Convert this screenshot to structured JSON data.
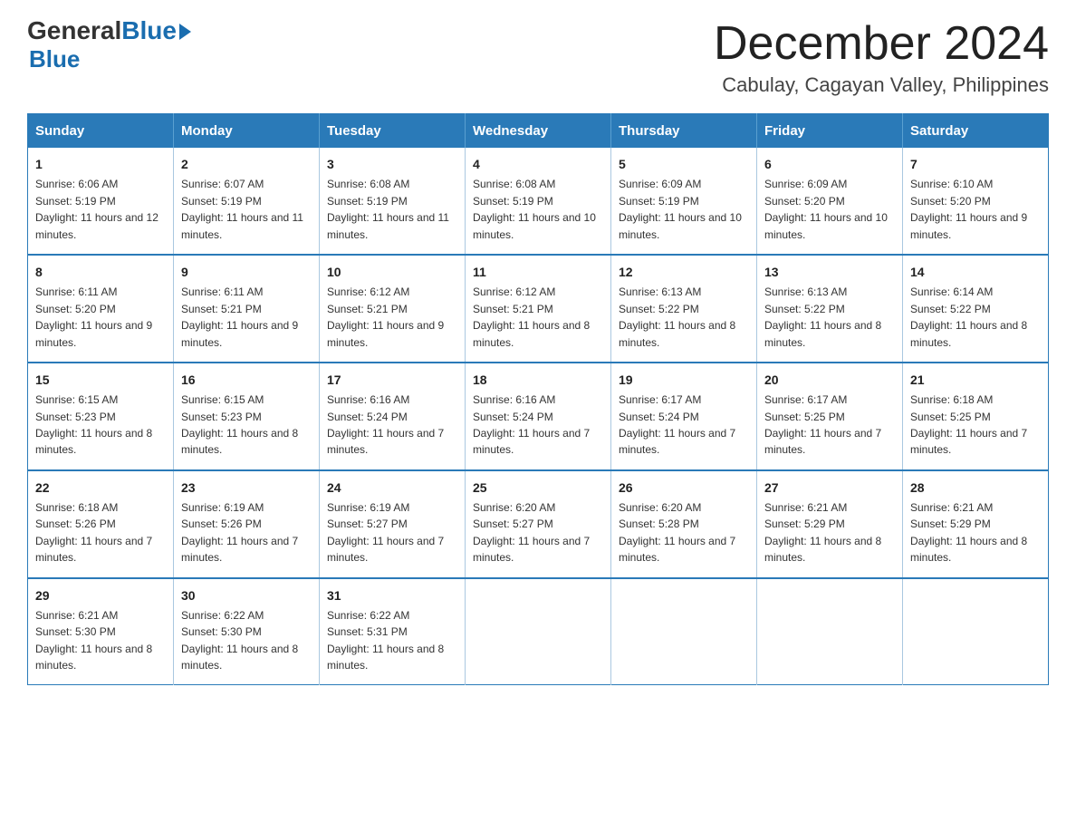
{
  "logo": {
    "general": "General",
    "blue": "Blue",
    "triangle": true
  },
  "header": {
    "month_title": "December 2024",
    "location": "Cabulay, Cagayan Valley, Philippines"
  },
  "days_of_week": [
    "Sunday",
    "Monday",
    "Tuesday",
    "Wednesday",
    "Thursday",
    "Friday",
    "Saturday"
  ],
  "weeks": [
    [
      {
        "day": "1",
        "sunrise": "6:06 AM",
        "sunset": "5:19 PM",
        "daylight": "11 hours and 12 minutes."
      },
      {
        "day": "2",
        "sunrise": "6:07 AM",
        "sunset": "5:19 PM",
        "daylight": "11 hours and 11 minutes."
      },
      {
        "day": "3",
        "sunrise": "6:08 AM",
        "sunset": "5:19 PM",
        "daylight": "11 hours and 11 minutes."
      },
      {
        "day": "4",
        "sunrise": "6:08 AM",
        "sunset": "5:19 PM",
        "daylight": "11 hours and 10 minutes."
      },
      {
        "day": "5",
        "sunrise": "6:09 AM",
        "sunset": "5:19 PM",
        "daylight": "11 hours and 10 minutes."
      },
      {
        "day": "6",
        "sunrise": "6:09 AM",
        "sunset": "5:20 PM",
        "daylight": "11 hours and 10 minutes."
      },
      {
        "day": "7",
        "sunrise": "6:10 AM",
        "sunset": "5:20 PM",
        "daylight": "11 hours and 9 minutes."
      }
    ],
    [
      {
        "day": "8",
        "sunrise": "6:11 AM",
        "sunset": "5:20 PM",
        "daylight": "11 hours and 9 minutes."
      },
      {
        "day": "9",
        "sunrise": "6:11 AM",
        "sunset": "5:21 PM",
        "daylight": "11 hours and 9 minutes."
      },
      {
        "day": "10",
        "sunrise": "6:12 AM",
        "sunset": "5:21 PM",
        "daylight": "11 hours and 9 minutes."
      },
      {
        "day": "11",
        "sunrise": "6:12 AM",
        "sunset": "5:21 PM",
        "daylight": "11 hours and 8 minutes."
      },
      {
        "day": "12",
        "sunrise": "6:13 AM",
        "sunset": "5:22 PM",
        "daylight": "11 hours and 8 minutes."
      },
      {
        "day": "13",
        "sunrise": "6:13 AM",
        "sunset": "5:22 PM",
        "daylight": "11 hours and 8 minutes."
      },
      {
        "day": "14",
        "sunrise": "6:14 AM",
        "sunset": "5:22 PM",
        "daylight": "11 hours and 8 minutes."
      }
    ],
    [
      {
        "day": "15",
        "sunrise": "6:15 AM",
        "sunset": "5:23 PM",
        "daylight": "11 hours and 8 minutes."
      },
      {
        "day": "16",
        "sunrise": "6:15 AM",
        "sunset": "5:23 PM",
        "daylight": "11 hours and 8 minutes."
      },
      {
        "day": "17",
        "sunrise": "6:16 AM",
        "sunset": "5:24 PM",
        "daylight": "11 hours and 7 minutes."
      },
      {
        "day": "18",
        "sunrise": "6:16 AM",
        "sunset": "5:24 PM",
        "daylight": "11 hours and 7 minutes."
      },
      {
        "day": "19",
        "sunrise": "6:17 AM",
        "sunset": "5:24 PM",
        "daylight": "11 hours and 7 minutes."
      },
      {
        "day": "20",
        "sunrise": "6:17 AM",
        "sunset": "5:25 PM",
        "daylight": "11 hours and 7 minutes."
      },
      {
        "day": "21",
        "sunrise": "6:18 AM",
        "sunset": "5:25 PM",
        "daylight": "11 hours and 7 minutes."
      }
    ],
    [
      {
        "day": "22",
        "sunrise": "6:18 AM",
        "sunset": "5:26 PM",
        "daylight": "11 hours and 7 minutes."
      },
      {
        "day": "23",
        "sunrise": "6:19 AM",
        "sunset": "5:26 PM",
        "daylight": "11 hours and 7 minutes."
      },
      {
        "day": "24",
        "sunrise": "6:19 AM",
        "sunset": "5:27 PM",
        "daylight": "11 hours and 7 minutes."
      },
      {
        "day": "25",
        "sunrise": "6:20 AM",
        "sunset": "5:27 PM",
        "daylight": "11 hours and 7 minutes."
      },
      {
        "day": "26",
        "sunrise": "6:20 AM",
        "sunset": "5:28 PM",
        "daylight": "11 hours and 7 minutes."
      },
      {
        "day": "27",
        "sunrise": "6:21 AM",
        "sunset": "5:29 PM",
        "daylight": "11 hours and 8 minutes."
      },
      {
        "day": "28",
        "sunrise": "6:21 AM",
        "sunset": "5:29 PM",
        "daylight": "11 hours and 8 minutes."
      }
    ],
    [
      {
        "day": "29",
        "sunrise": "6:21 AM",
        "sunset": "5:30 PM",
        "daylight": "11 hours and 8 minutes."
      },
      {
        "day": "30",
        "sunrise": "6:22 AM",
        "sunset": "5:30 PM",
        "daylight": "11 hours and 8 minutes."
      },
      {
        "day": "31",
        "sunrise": "6:22 AM",
        "sunset": "5:31 PM",
        "daylight": "11 hours and 8 minutes."
      },
      null,
      null,
      null,
      null
    ]
  ]
}
